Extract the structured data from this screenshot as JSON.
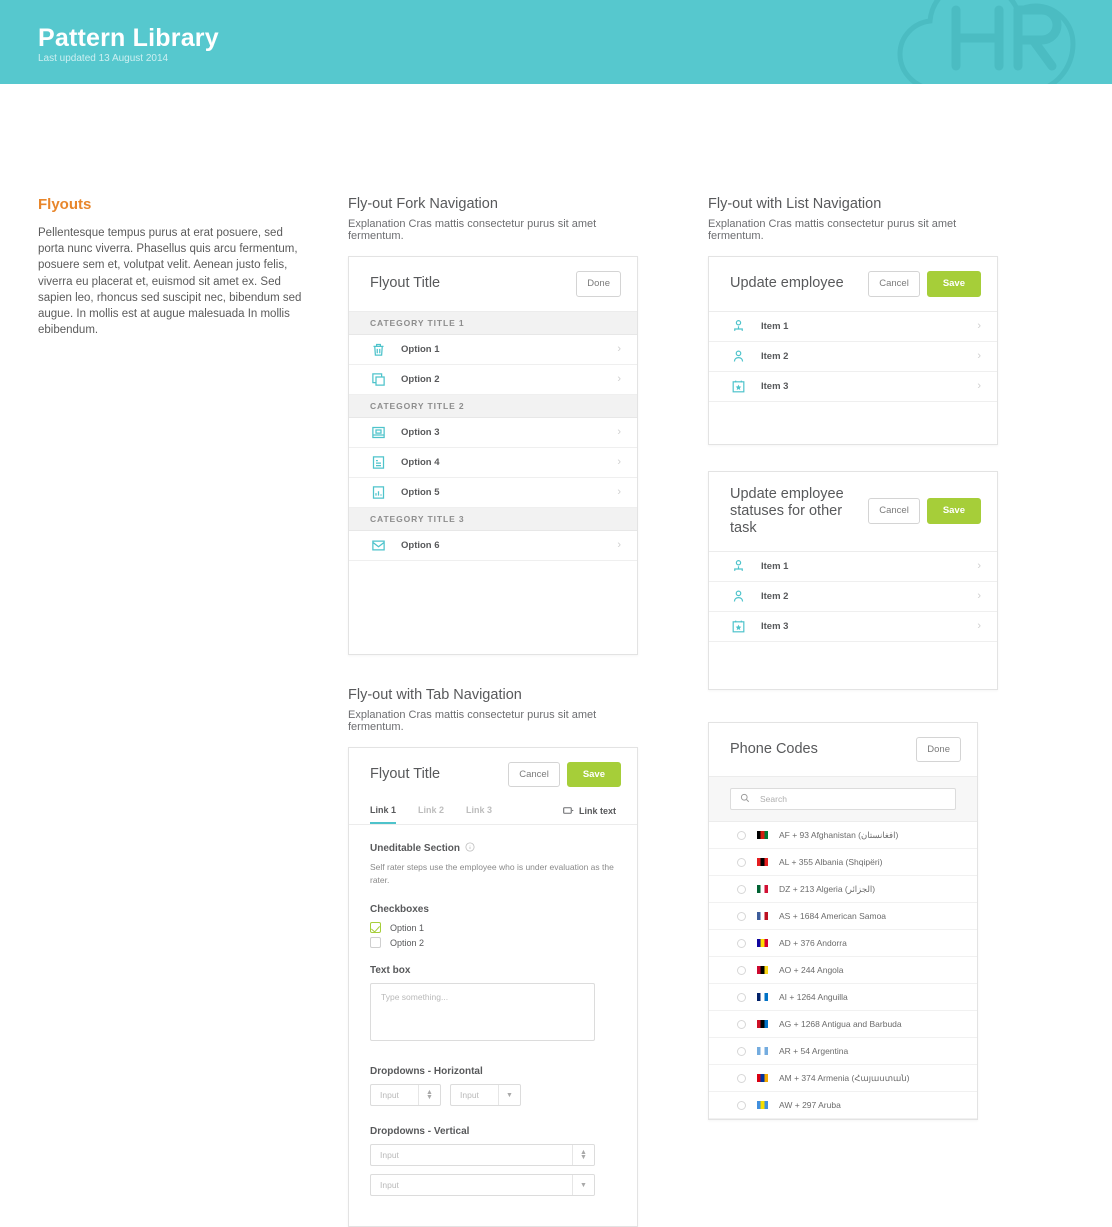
{
  "header": {
    "title": "Pattern Library",
    "subtitle": "Last updated 13 August 2014",
    "logo_text": "HR",
    "bg_color": "#56c8ce"
  },
  "colors": {
    "teal": "#4ec3cb",
    "green": "#a6ce39",
    "orange": "#e8862b"
  },
  "left": {
    "heading": "Flyouts",
    "body": "Pellentesque tempus purus at erat posuere, sed porta nunc viverra. Phasellus quis arcu fermentum, posuere sem et, volutpat velit. Aenean justo felis, viverra eu placerat et, euismod sit amet ex. Sed sapien leo, rhoncus sed suscipit nec, bibendum sed augue. In mollis est at augue malesuada  In mollis ebibendum."
  },
  "fork_nav": {
    "title": "Fly-out Fork Navigation",
    "subtitle": "Explanation Cras mattis consectetur purus sit amet fermentum.",
    "flyout_title": "Flyout Title",
    "done_label": "Done",
    "groups": [
      {
        "category": "Category Title 1",
        "options": [
          {
            "label": "Option 1",
            "icon": "trash-icon"
          },
          {
            "label": "Option 2",
            "icon": "copy-icon"
          }
        ]
      },
      {
        "category": "Category Title 2",
        "options": [
          {
            "label": "Option 3",
            "icon": "document-lock-icon"
          },
          {
            "label": "Option 4",
            "icon": "document-text-icon"
          },
          {
            "label": "Option 5",
            "icon": "document-chart-icon"
          }
        ]
      },
      {
        "category": "Category Title 3",
        "options": [
          {
            "label": "Option 6",
            "icon": "envelope-icon"
          }
        ]
      }
    ]
  },
  "list_nav": {
    "title": "Fly-out with List Navigation",
    "subtitle": "Explanation Cras mattis consectetur purus sit amet fermentum.",
    "panel_one": {
      "flyout_title": "Update employee",
      "cancel_label": "Cancel",
      "save_label": "Save",
      "items": [
        {
          "label": "Item 1",
          "icon": "person-org-icon"
        },
        {
          "label": "Item 2",
          "icon": "person-icon"
        },
        {
          "label": "Item 3",
          "icon": "calendar-star-icon"
        }
      ]
    },
    "panel_two": {
      "flyout_title_line1": "Update employee",
      "flyout_title_line2": "statuses for other task",
      "cancel_label": "Cancel",
      "save_label": "Save",
      "items": [
        {
          "label": "Item 1",
          "icon": "person-org-icon"
        },
        {
          "label": "Item 2",
          "icon": "person-icon"
        },
        {
          "label": "Item 3",
          "icon": "calendar-star-icon"
        }
      ]
    }
  },
  "tab_nav": {
    "title": "Fly-out with Tab Navigation",
    "subtitle": "Explanation Cras mattis consectetur purus sit amet fermentum.",
    "flyout_title": "Flyout Title",
    "cancel_label": "Cancel",
    "save_label": "Save",
    "tabs": [
      {
        "label": "Link 1",
        "active": true
      },
      {
        "label": "Link 2",
        "active": false
      },
      {
        "label": "Link 3",
        "active": false
      }
    ],
    "tab_right_label": "Link text",
    "uneditable_heading": "Uneditable Section",
    "uneditable_body": "Self rater steps use the employee who is under evaluation as the rater.",
    "checkboxes_label": "Checkboxes",
    "checkboxes": [
      {
        "label": "Option 1",
        "checked": true
      },
      {
        "label": "Option 2",
        "checked": false
      }
    ],
    "textbox_label": "Text box",
    "textbox_placeholder": "Type something...",
    "textbox_value": "",
    "dropdowns_h_label": "Dropdowns - Horizontal",
    "dropdowns_v_label": "Dropdowns - Vertical",
    "dropdown_placeholder": "Input",
    "dropdown_value": ""
  },
  "phone_codes": {
    "flyout_title": "Phone Codes",
    "done_label": "Done",
    "search_placeholder": "Search",
    "search_value": "",
    "rows": [
      {
        "label": "AF + 93 Afghanistan (افغانستان)",
        "flag": [
          "#000000",
          "#d32011",
          "#007a36"
        ]
      },
      {
        "label": "AL + 355 Albania (Shqipëri)",
        "flag": [
          "#e41e20",
          "#000000",
          "#e41e20"
        ]
      },
      {
        "label": "DZ + 213 Algeria (الجزائر)",
        "flag": [
          "#006233",
          "#ffffff",
          "#d21034"
        ]
      },
      {
        "label": "AS + 1684 American Samoa",
        "flag": [
          "#3d5d9b",
          "#ffffff",
          "#bd1021"
        ]
      },
      {
        "label": "AD + 376 Andorra",
        "flag": [
          "#10069f",
          "#fedd00",
          "#d50032"
        ]
      },
      {
        "label": "AO + 244 Angola",
        "flag": [
          "#cc092f",
          "#000000",
          "#f9d616"
        ]
      },
      {
        "label": "AI + 1264 Anguilla",
        "flag": [
          "#012169",
          "#ffffff",
          "#0072c6"
        ]
      },
      {
        "label": "AG + 1268 Antigua and Barbuda",
        "flag": [
          "#ce1126",
          "#000000",
          "#0072c6"
        ]
      },
      {
        "label": "AR + 54 Argentina",
        "flag": [
          "#74acdf",
          "#ffffff",
          "#74acdf"
        ]
      },
      {
        "label": "AM + 374 Armenia (Հայաստան)",
        "flag": [
          "#d90012",
          "#0033a0",
          "#f2a800"
        ]
      },
      {
        "label": "AW + 297 Aruba",
        "flag": [
          "#418fde",
          "#f7de00",
          "#418fde"
        ]
      }
    ]
  }
}
